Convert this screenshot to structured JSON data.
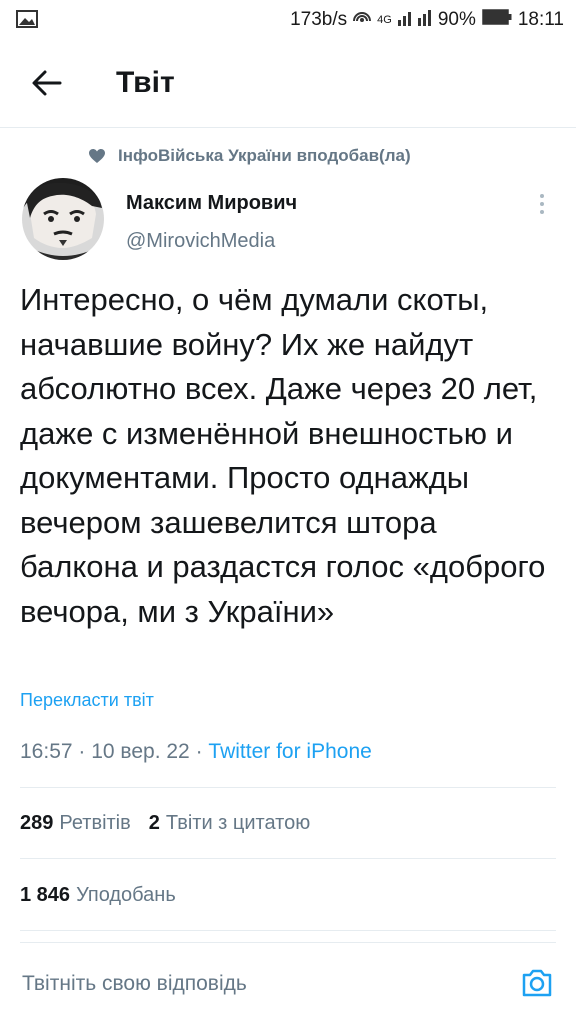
{
  "status_bar": {
    "speed": "173b/s",
    "network": "4G",
    "battery": "90%",
    "time": "18:11"
  },
  "header": {
    "title": "Твіт",
    "back_icon": "arrow-left-icon"
  },
  "tweet": {
    "social_context": "ІнфоВійська України вподобав(ла)",
    "author_name": "Максим Мирович",
    "author_handle": "@MirovichMedia",
    "text": "Интересно, о чём думали скоты, начавшие войну? Их же найдут абсолютно всех. Даже через 20 лет, даже с изменённой внешностью и документами. Просто однажды вечером зашевелится штора балкона и раздастся голос «доброго вечора, ми з України»",
    "translate_link": "Перекласти твіт",
    "time": "16:57",
    "date": "10 вер. 22",
    "source": "Twitter for iPhone",
    "retweets_count": "289",
    "retweets_label": "Ретвітів",
    "quotes_count": "2",
    "quotes_label": "Твіти з цитатою",
    "likes_count": "1 846",
    "likes_label": "Уподобань"
  },
  "reply": {
    "placeholder": "Твітніть свою відповідь",
    "camera_icon": "camera-icon"
  },
  "colors": {
    "accent": "#1da1f2",
    "secondary_text": "#657786",
    "divider": "#e6ecf0"
  }
}
